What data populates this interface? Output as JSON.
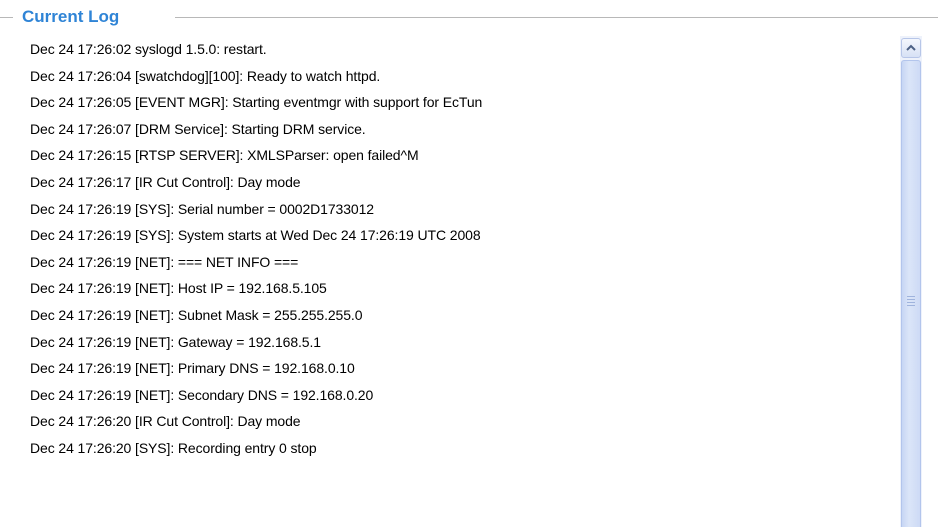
{
  "section": {
    "title": "Current Log"
  },
  "log": {
    "lines": [
      "Dec 24 17:26:02 syslogd 1.5.0: restart.",
      "Dec 24 17:26:04 [swatchdog][100]: Ready to watch httpd.",
      "Dec 24 17:26:05 [EVENT MGR]: Starting eventmgr with support for EcTun",
      "Dec 24 17:26:07 [DRM Service]: Starting DRM service.",
      "Dec 24 17:26:15 [RTSP SERVER]: XMLSParser: open failed^M",
      "Dec 24 17:26:17 [IR Cut Control]: Day mode",
      "Dec 24 17:26:19 [SYS]: Serial number = 0002D1733012",
      "Dec 24 17:26:19 [SYS]: System starts at Wed Dec 24 17:26:19 UTC 2008",
      "Dec 24 17:26:19 [NET]: === NET INFO ===",
      "Dec 24 17:26:19 [NET]: Host IP = 192.168.5.105",
      "Dec 24 17:26:19 [NET]: Subnet Mask = 255.255.255.0",
      "Dec 24 17:26:19 [NET]: Gateway = 192.168.5.1",
      "Dec 24 17:26:19 [NET]: Primary DNS = 192.168.0.10",
      "Dec 24 17:26:19 [NET]: Secondary DNS = 192.168.0.20",
      "Dec 24 17:26:20 [IR Cut Control]: Day mode",
      "Dec 24 17:26:20 [SYS]: Recording entry 0 stop"
    ]
  },
  "scrollbar": {
    "up_icon": "chevron-up-icon",
    "thumb_grip_icon": "grip-lines-icon"
  },
  "colors": {
    "legend": "#2f84d6",
    "scroll_track": "#eef2fb",
    "scroll_thumb": "#c7d6f4"
  }
}
